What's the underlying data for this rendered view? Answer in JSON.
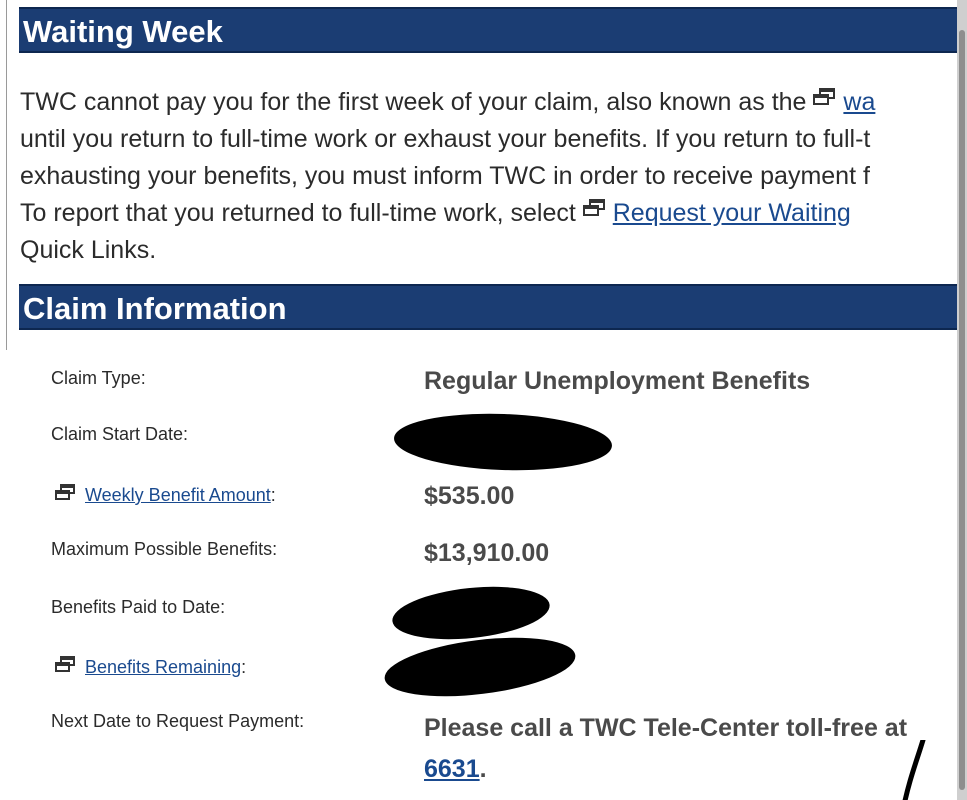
{
  "waiting_week": {
    "title": "Waiting Week",
    "line1_text": "TWC cannot pay you for the first week of your claim, also known as the ",
    "line1_link": "wa",
    "line2": "until you return to full-time work or exhaust your benefits. If you return to full-t",
    "line3": "exhausting your benefits, you must inform TWC in order to receive payment f",
    "line4_text": "To report that you returned to full-time work, select ",
    "line4_link": "Request your Waiting",
    "line5": "Quick Links."
  },
  "claim_info": {
    "title": "Claim Information",
    "claim_type_label": "Claim Type:",
    "claim_type_value": "Regular Unemployment Benefits",
    "start_date_label": "Claim Start Date:",
    "weekly_amount_link": "Weekly Benefit Amount",
    "weekly_amount_colon": ":",
    "weekly_amount_value": "$535.00",
    "max_benefits_label": "Maximum Possible Benefits:",
    "max_benefits_value": "$13,910.00",
    "paid_to_date_label": "Benefits Paid to Date:",
    "remaining_link": "Benefits Remaining",
    "remaining_colon": ":",
    "next_date_label": "Next Date to Request Payment:",
    "next_date_value_line1": "Please call a TWC Tele-Center toll-free at",
    "next_date_phone": "6631",
    "next_date_period": "."
  },
  "icons": {
    "popup": "new-window-icon"
  },
  "colors": {
    "header_bg": "#1b3d73",
    "link": "#1a4a8f"
  }
}
